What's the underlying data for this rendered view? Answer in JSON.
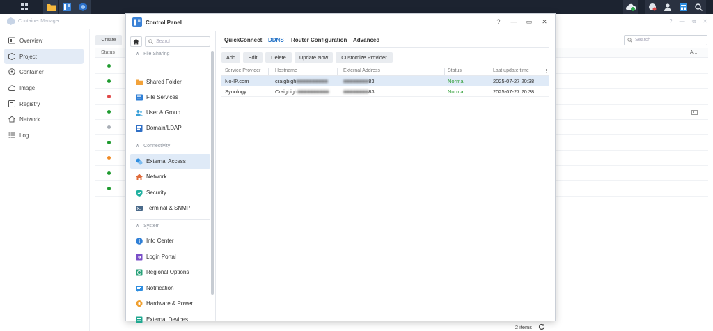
{
  "taskbar": {
    "icons": [
      "apps-grid-icon",
      "file-station-icon",
      "control-panel-icon",
      "container-manager-icon"
    ],
    "tray_icons": [
      "cloud-sync-icon",
      "chat-icon",
      "user-icon",
      "widgets-icon",
      "search-icon"
    ]
  },
  "container_manager": {
    "title": "Container Manager",
    "sidebar": [
      {
        "label": "Overview",
        "icon": "overview-icon"
      },
      {
        "label": "Project",
        "icon": "project-icon"
      },
      {
        "label": "Container",
        "icon": "container-icon"
      },
      {
        "label": "Image",
        "icon": "image-icon"
      },
      {
        "label": "Registry",
        "icon": "registry-icon"
      },
      {
        "label": "Network",
        "icon": "network-icon"
      },
      {
        "label": "Log",
        "icon": "log-icon"
      }
    ],
    "create_label": "Create",
    "status_header": "Status",
    "right_header": "A...",
    "search_placeholder": "Search",
    "row_status_colors": [
      "#1e9a2e",
      "#1e9a2e",
      "#e04848",
      "#1e9a2e",
      "#a8aeb6",
      "#1e9a2e",
      "#f08a24",
      "#1e9a2e",
      "#1e9a2e"
    ]
  },
  "control_panel": {
    "title": "Control Panel",
    "window_controls": [
      "?",
      "—",
      "▭",
      "✕"
    ],
    "search_placeholder": "Search",
    "sections": [
      {
        "label": "File Sharing",
        "items": [
          {
            "label": "Shared Folder",
            "icon": "shared-folder-icon",
            "color": "#f2a23a"
          },
          {
            "label": "File Services",
            "icon": "file-services-icon",
            "color": "#2f7fd6"
          },
          {
            "label": "User & Group",
            "icon": "user-group-icon",
            "color": "#3aa0d8"
          },
          {
            "label": "Domain/LDAP",
            "icon": "domain-ldap-icon",
            "color": "#2f6fc5"
          }
        ]
      },
      {
        "label": "Connectivity",
        "items": [
          {
            "label": "External Access",
            "icon": "external-access-icon",
            "color": "#2f8ee0"
          },
          {
            "label": "Network",
            "icon": "network-home-icon",
            "color": "#e06b3a"
          },
          {
            "label": "Security",
            "icon": "security-shield-icon",
            "color": "#20b0a0"
          },
          {
            "label": "Terminal & SNMP",
            "icon": "terminal-icon",
            "color": "#4a6a8a"
          }
        ]
      },
      {
        "label": "System",
        "items": [
          {
            "label": "Info Center",
            "icon": "info-center-icon",
            "color": "#2f7fd6"
          },
          {
            "label": "Login Portal",
            "icon": "login-portal-icon",
            "color": "#7a4fc8"
          },
          {
            "label": "Regional Options",
            "icon": "regional-options-icon",
            "color": "#2aa27a"
          },
          {
            "label": "Notification",
            "icon": "notification-icon",
            "color": "#2f8ee0"
          },
          {
            "label": "Hardware & Power",
            "icon": "hardware-power-icon",
            "color": "#f0a030"
          },
          {
            "label": "External Devices",
            "icon": "external-devices-icon",
            "color": "#20a890"
          }
        ]
      }
    ],
    "tabs": [
      "QuickConnect",
      "DDNS",
      "Router Configuration",
      "Advanced"
    ],
    "active_tab": "DDNS",
    "toolbar": [
      "Add",
      "Edit",
      "Delete",
      "Update Now",
      "Customize Provider"
    ],
    "columns": [
      "Service Provider",
      "Hostname",
      "External Address",
      "Status",
      "Last update time"
    ],
    "rows": [
      {
        "provider": "No-IP.com",
        "hostname": "craigbigh",
        "hostname_blur": "■■■■■■■■■■",
        "address_blur": "■■■■■■■■",
        "address_tail": "83",
        "status": "Normal",
        "updated": "2025-07-27 20:38"
      },
      {
        "provider": "Synology",
        "hostname": "Craigbigh",
        "hostname_blur": "■■■■■■■■■■",
        "address_blur": "■■■■■■■■",
        "address_tail": "83",
        "status": "Normal",
        "updated": "2025-07-27 20:38"
      }
    ],
    "item_count": "2 items",
    "accent": "#1f6fc5",
    "status_color": "#2e9e35"
  }
}
